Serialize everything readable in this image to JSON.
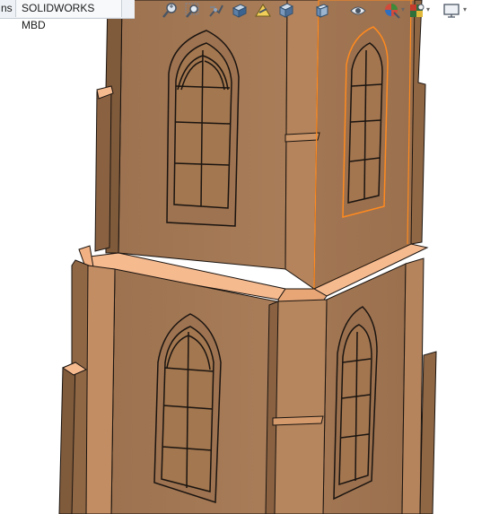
{
  "tabs": {
    "partial_label": "ns",
    "mbd_label": "SOLIDWORKS MBD"
  },
  "heads_up_toolbar": {
    "tools": [
      {
        "icon": "zoom-to-fit-icon"
      },
      {
        "icon": "zoom-to-area-icon"
      },
      {
        "icon": "previous-view-icon"
      },
      {
        "icon": "section-view-icon"
      },
      {
        "icon": "dynamic-annotation-views-icon"
      },
      {
        "icon": "view-orientation-icon"
      },
      {
        "icon": "display-style-icon"
      },
      {
        "icon": "hide-show-items-icon"
      },
      {
        "icon": "edit-appearance-icon"
      },
      {
        "icon": "apply-scene-icon"
      },
      {
        "icon": "view-settings-icon"
      }
    ]
  },
  "colors": {
    "wall": "#a67a56",
    "wall_side": "#8f6745",
    "pilaster_light": "#c28d63",
    "pilaster_dark": "#7f5a3b",
    "highlight": "#f6ba8f",
    "selection": "#ff8a1f",
    "edge": "#1a1410"
  }
}
